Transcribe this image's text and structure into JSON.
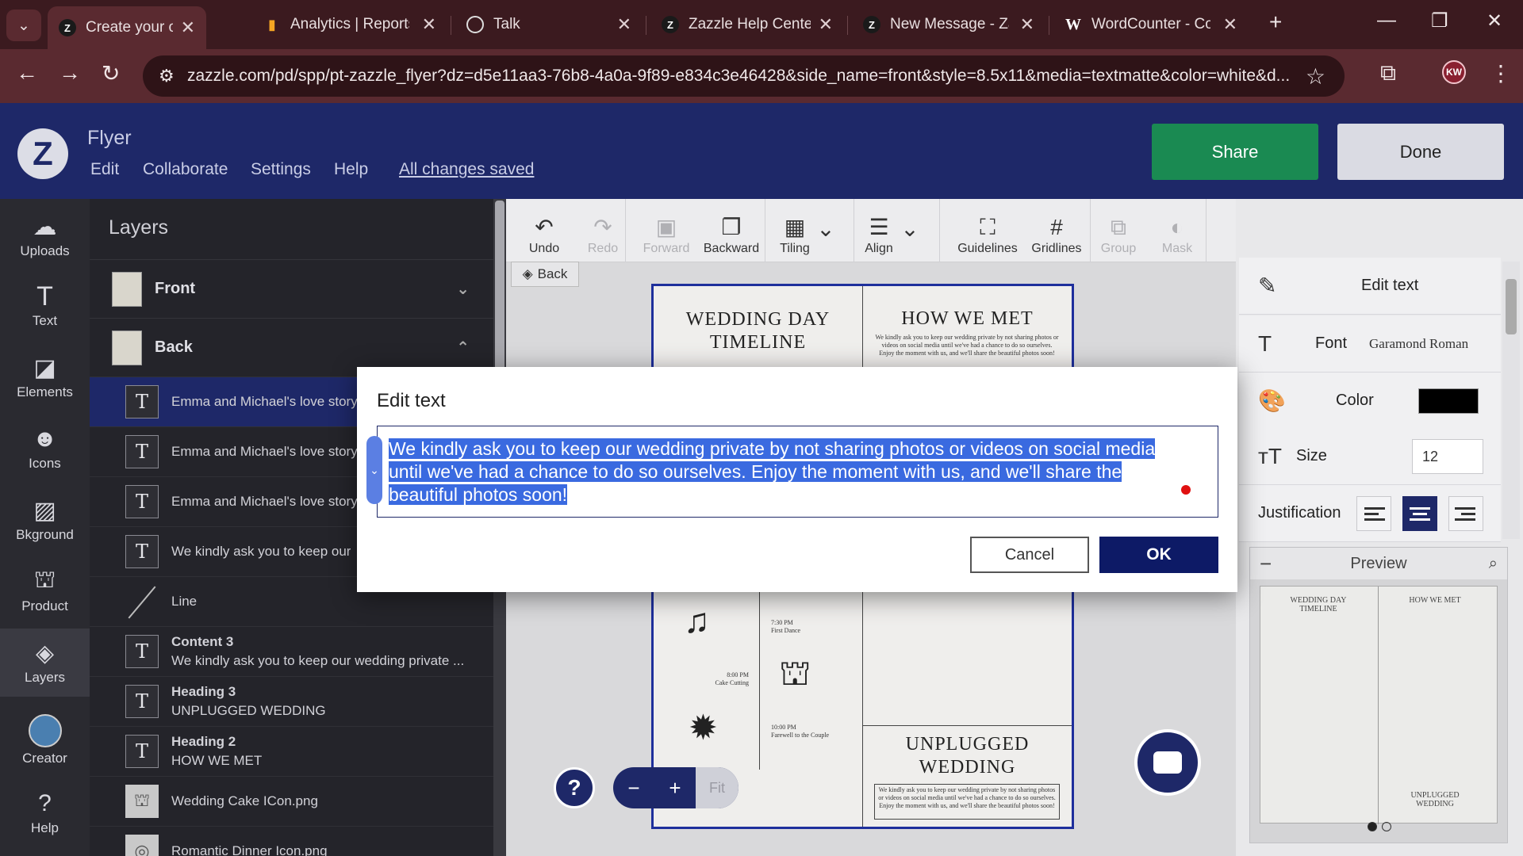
{
  "browser": {
    "tabs": [
      {
        "label": "Create your own Fl",
        "icon": "Z",
        "active": true
      },
      {
        "label": "Analytics | Reports",
        "icon": "analytics"
      },
      {
        "label": "Talk",
        "icon": "openai"
      },
      {
        "label": "Zazzle Help Center",
        "icon": "Z"
      },
      {
        "label": "New Message - Za",
        "icon": "Z"
      },
      {
        "label": "WordCounter - Co",
        "icon": "W"
      }
    ],
    "url": "zazzle.com/pd/spp/pt-zazzle_flyer?dz=d5e11aa3-76b8-4a0a-9f89-e834c3e46428&side_name=front&style=8.5x11&media=textmatte&color=white&d...",
    "profile_initials": "KW"
  },
  "header": {
    "app_title": "Flyer",
    "menu": [
      "Edit",
      "Collaborate",
      "Settings",
      "Help"
    ],
    "save_status": "All changes saved",
    "share_label": "Share",
    "done_label": "Done"
  },
  "rail": {
    "items": [
      {
        "label": "Uploads",
        "icon": "cloud-upload-icon"
      },
      {
        "label": "Text",
        "icon": "text-icon"
      },
      {
        "label": "Elements",
        "icon": "elements-icon"
      },
      {
        "label": "Icons",
        "icon": "smiley-icon"
      },
      {
        "label": "Bkground",
        "icon": "background-icon"
      },
      {
        "label": "Product",
        "icon": "product-icon"
      },
      {
        "label": "Layers",
        "icon": "layers-icon"
      },
      {
        "label": "Creator",
        "icon": "avatar"
      },
      {
        "label": "Help",
        "icon": "help-icon"
      }
    ]
  },
  "layers": {
    "title": "Layers",
    "groups": [
      "Front",
      "Back"
    ],
    "rows": [
      {
        "type": "text",
        "title": "",
        "text": "Emma and Michael's love story"
      },
      {
        "type": "text",
        "title": "",
        "text": "Emma and Michael's love story"
      },
      {
        "type": "text",
        "title": "",
        "text": "Emma and Michael's love story"
      },
      {
        "type": "text",
        "title": "",
        "text": "We kindly ask you to keep our"
      },
      {
        "type": "line",
        "title": "",
        "text": "Line"
      },
      {
        "type": "text",
        "title": "Content 3",
        "text": "We kindly ask you to keep our wedding private ..."
      },
      {
        "type": "text",
        "title": "Heading 3",
        "text": "UNPLUGGED WEDDING"
      },
      {
        "type": "text",
        "title": "Heading 2",
        "text": "HOW WE MET"
      },
      {
        "type": "image",
        "title": "",
        "text": "Wedding Cake ICon.png"
      },
      {
        "type": "image",
        "title": "",
        "text": "Romantic Dinner Icon.png"
      }
    ]
  },
  "toolbar": {
    "tools": [
      {
        "label": "Undo",
        "glyph": "↶",
        "disabled": false
      },
      {
        "label": "Redo",
        "glyph": "↷",
        "disabled": true
      },
      {
        "label": "Forward",
        "glyph": "▣",
        "disabled": true
      },
      {
        "label": "Backward",
        "glyph": "❐",
        "disabled": false
      },
      {
        "label": "Tiling",
        "glyph": "▦",
        "disabled": false
      },
      {
        "label": "Align",
        "glyph": "☰",
        "disabled": false
      },
      {
        "label": "Guidelines",
        "glyph": "⛶",
        "disabled": false
      },
      {
        "label": "Gridlines",
        "glyph": "#",
        "disabled": false
      },
      {
        "label": "Group",
        "glyph": "⧉",
        "disabled": true
      },
      {
        "label": "Mask",
        "glyph": "◐",
        "disabled": true
      }
    ],
    "back_label": "Back"
  },
  "flyer": {
    "heading_timeline": "WEDDING DAY\nTIMELINE",
    "heading_how_we_met": "HOW WE MET",
    "heading_unplugged": "UNPLUGGED\nWEDDING",
    "small_text": "We kindly ask you to keep our wedding private by not sharing photos or videos on social media until we've had a chance to do so ourselves. Enjoy the moment with us, and we'll share the beautiful photos soon!",
    "timeline": [
      {
        "time": "7:30 PM",
        "event": "First Dance"
      },
      {
        "time": "8:00 PM",
        "event": "Cake Cutting"
      },
      {
        "time": "10:00 PM",
        "event": "Farewell to the Couple"
      }
    ]
  },
  "zoom": {
    "minus": "−",
    "plus": "+",
    "fit": "Fit",
    "help": "?"
  },
  "right_panel": {
    "edit_text_label": "Edit text",
    "font_label": "Font",
    "font_value": "Garamond Roman",
    "color_label": "Color",
    "color_value": "#000000",
    "size_label": "Size",
    "size_value": "12",
    "justification_label": "Justification",
    "preview_label": "Preview",
    "preview_heading_1": "WEDDING DAY\nTIMELINE",
    "preview_heading_2": "HOW WE MET",
    "preview_heading_3": "UNPLUGGED\nWEDDING"
  },
  "modal": {
    "title": "Edit text",
    "text": "We kindly ask you to keep our wedding private by not sharing photos or videos on social media until we've had a chance to do so ourselves. Enjoy the moment with us, and we'll share the beautiful photos soon!",
    "cancel_label": "Cancel",
    "ok_label": "OK"
  }
}
